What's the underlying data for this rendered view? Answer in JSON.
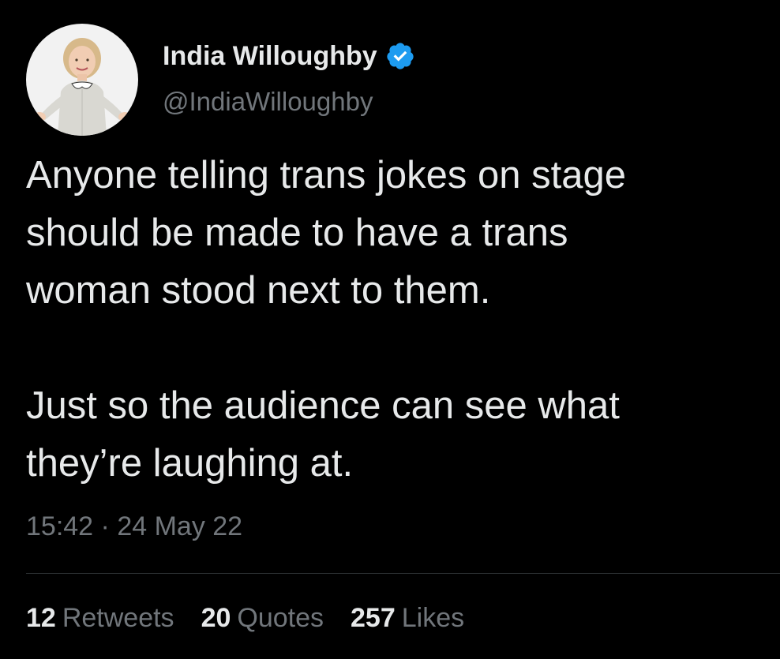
{
  "author": {
    "display_name": "India Willoughby",
    "handle": "@IndiaWilloughby",
    "verified_icon": "verified-badge-icon",
    "avatar_icon": "profile-photo"
  },
  "tweet": {
    "paragraphs": [
      "Anyone telling trans jokes on stage\nshould be made to have a trans\nwoman stood next to them.",
      "Just so the audience can see what\nthey’re laughing at."
    ],
    "time": "15:42",
    "separator": "·",
    "date": "24 May 22"
  },
  "stats": {
    "retweets": {
      "count": "12",
      "label": "Retweets"
    },
    "quotes": {
      "count": "20",
      "label": "Quotes"
    },
    "likes": {
      "count": "257",
      "label": "Likes"
    }
  },
  "colors": {
    "background": "#000000",
    "primary_text": "#e7e9ea",
    "secondary_text": "#71767b",
    "verified_blue": "#1d9bf0",
    "divider": "#2f3336"
  }
}
